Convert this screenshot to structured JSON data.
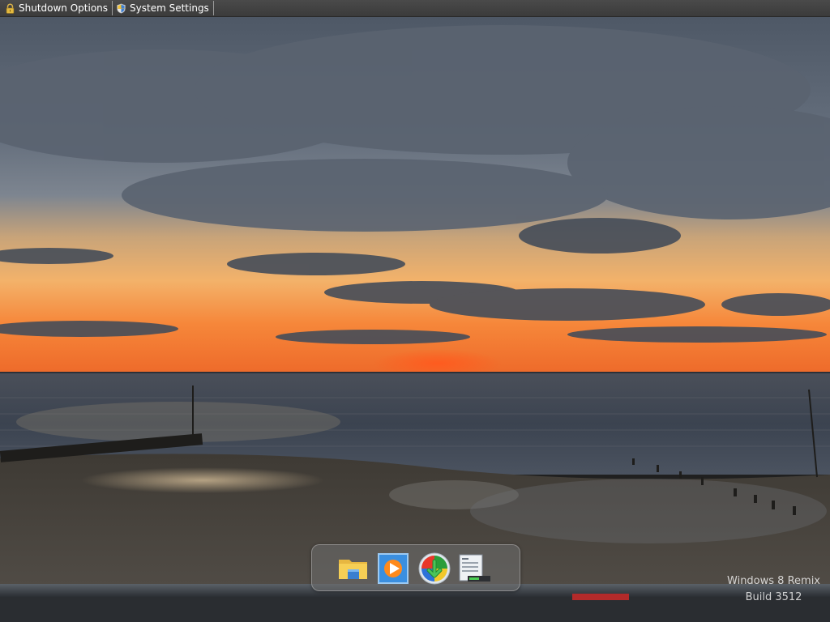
{
  "topbar": {
    "items": [
      {
        "label": "Shutdown Options",
        "icon": "lock-icon"
      },
      {
        "label": "System Settings",
        "icon": "gear-shield-icon"
      }
    ]
  },
  "dock": {
    "items": [
      {
        "name": "file-explorer",
        "icon": "folder-icon"
      },
      {
        "name": "media-player",
        "icon": "play-icon"
      },
      {
        "name": "start",
        "icon": "windows-orb-icon"
      },
      {
        "name": "task-manager",
        "icon": "task-manager-icon"
      }
    ]
  },
  "watermark": {
    "line1": "Windows 8 Remix",
    "line2": "Build 3512"
  },
  "colors": {
    "topbar": "#3b3b3b",
    "sky_top": "#56606e",
    "sunset": "#f07a2a",
    "sea": "#3d4552",
    "beach": "#4a4640"
  }
}
